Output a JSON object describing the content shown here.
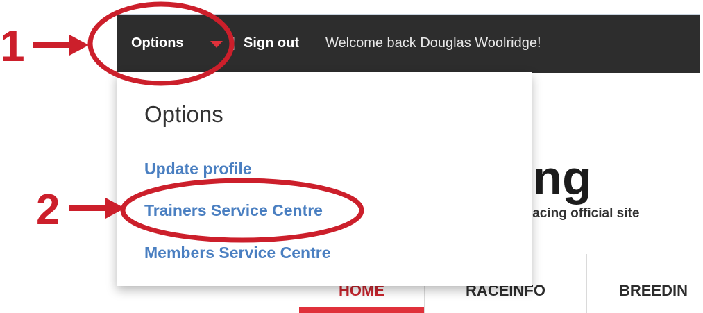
{
  "topbar": {
    "options_label": "Options",
    "separator": "|",
    "signout_label": "Sign out",
    "welcome_text": "Welcome back Douglas Woolridge!"
  },
  "brand": {
    "title_fragment": "cing",
    "tagline_fragment": "red racing official site"
  },
  "nav": {
    "items": [
      "HOME",
      "RACEINFO",
      "BREEDIN"
    ]
  },
  "dropdown": {
    "title": "Options",
    "items": [
      "Update profile",
      "Trainers Service Centre",
      "Members Service Centre"
    ]
  },
  "annotations": {
    "step1": "1",
    "step2": "2",
    "color": "#cc1f2b"
  }
}
